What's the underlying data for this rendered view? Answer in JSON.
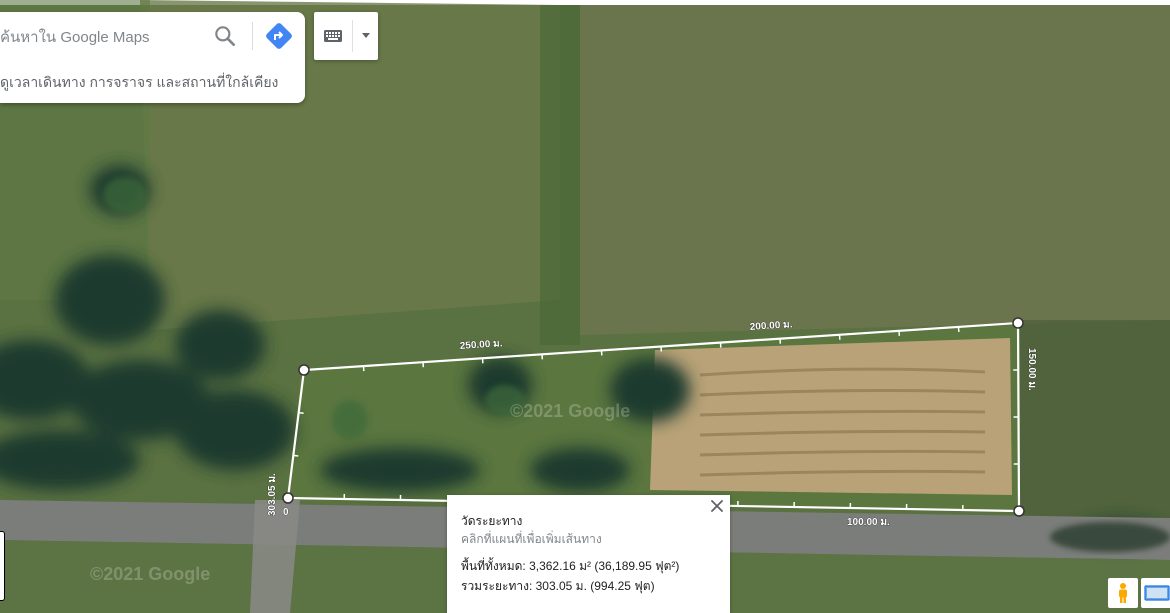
{
  "search": {
    "placeholder": "ค้นหาใน Google Maps",
    "hint": "ดูเวลาเดินทาง การจราจร และสถานที่ใกล้เคียง"
  },
  "map": {
    "watermark": "©2021 Google",
    "distance_labels": {
      "top_left": "250.00 ม.",
      "top_right": "200.00 ม.",
      "right": "150.00 ม.",
      "bottom": "100.00 ม.",
      "left": "303.05 ม.",
      "start": "0"
    }
  },
  "measure": {
    "title": "วัดระยะทาง",
    "subtitle": "คลิกที่แผนที่เพื่อเพิ่มเส้นทาง",
    "area": "พื้นที่ทั้งหมด: 3,362.16 ม² (36,189.95 ฟุต²)",
    "distance": "รวมระยะทาง: 303.05 ม. (994.25 ฟุต)"
  },
  "icons": {
    "search": "search-icon",
    "directions": "directions-icon",
    "keyboard": "keyboard-icon",
    "dropdown": "caret-down-icon",
    "close": "close-icon",
    "pegman": "pegman-icon",
    "layers": "layers-icon"
  },
  "colors": {
    "directions_blue": "#4285f4",
    "measure_line": "#ffffff"
  }
}
